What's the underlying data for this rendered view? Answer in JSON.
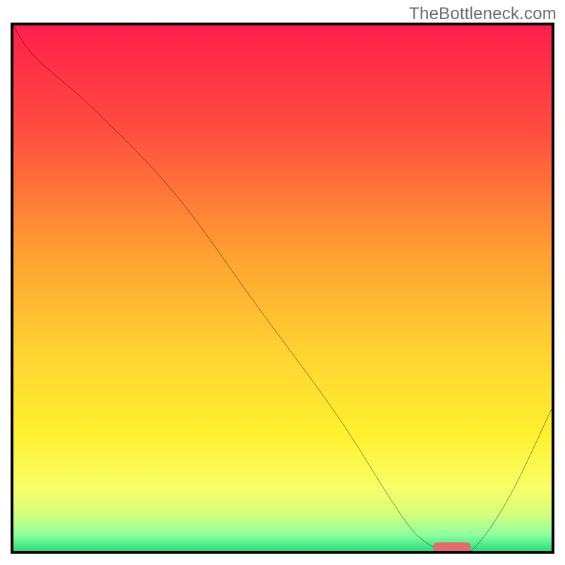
{
  "watermark": "TheBottleneck.com",
  "chart_data": {
    "type": "line",
    "title": "",
    "xlabel": "",
    "ylabel": "",
    "xlim": [
      0,
      100
    ],
    "ylim": [
      0,
      100
    ],
    "grid": false,
    "legend": false,
    "series": [
      {
        "name": "bottleneck-curve",
        "x": [
          0,
          4,
          15,
          30,
          45,
          60,
          70,
          75,
          80,
          85,
          92,
          100
        ],
        "values": [
          100,
          94,
          84,
          68,
          47,
          26,
          10,
          3,
          0,
          0,
          10,
          27
        ]
      }
    ],
    "optimum_marker": {
      "x_start": 78,
      "x_end": 85,
      "y": 0
    },
    "gradient_stops": [
      {
        "pct": 0,
        "color": "#ff1f4a"
      },
      {
        "pct": 20,
        "color": "#ff4d3f"
      },
      {
        "pct": 45,
        "color": "#ffa531"
      },
      {
        "pct": 63,
        "color": "#ffd531"
      },
      {
        "pct": 78,
        "color": "#fff130"
      },
      {
        "pct": 88,
        "color": "#f8ff67"
      },
      {
        "pct": 93,
        "color": "#d4ff7a"
      },
      {
        "pct": 97,
        "color": "#8effa0"
      },
      {
        "pct": 100,
        "color": "#25e07a"
      }
    ]
  }
}
